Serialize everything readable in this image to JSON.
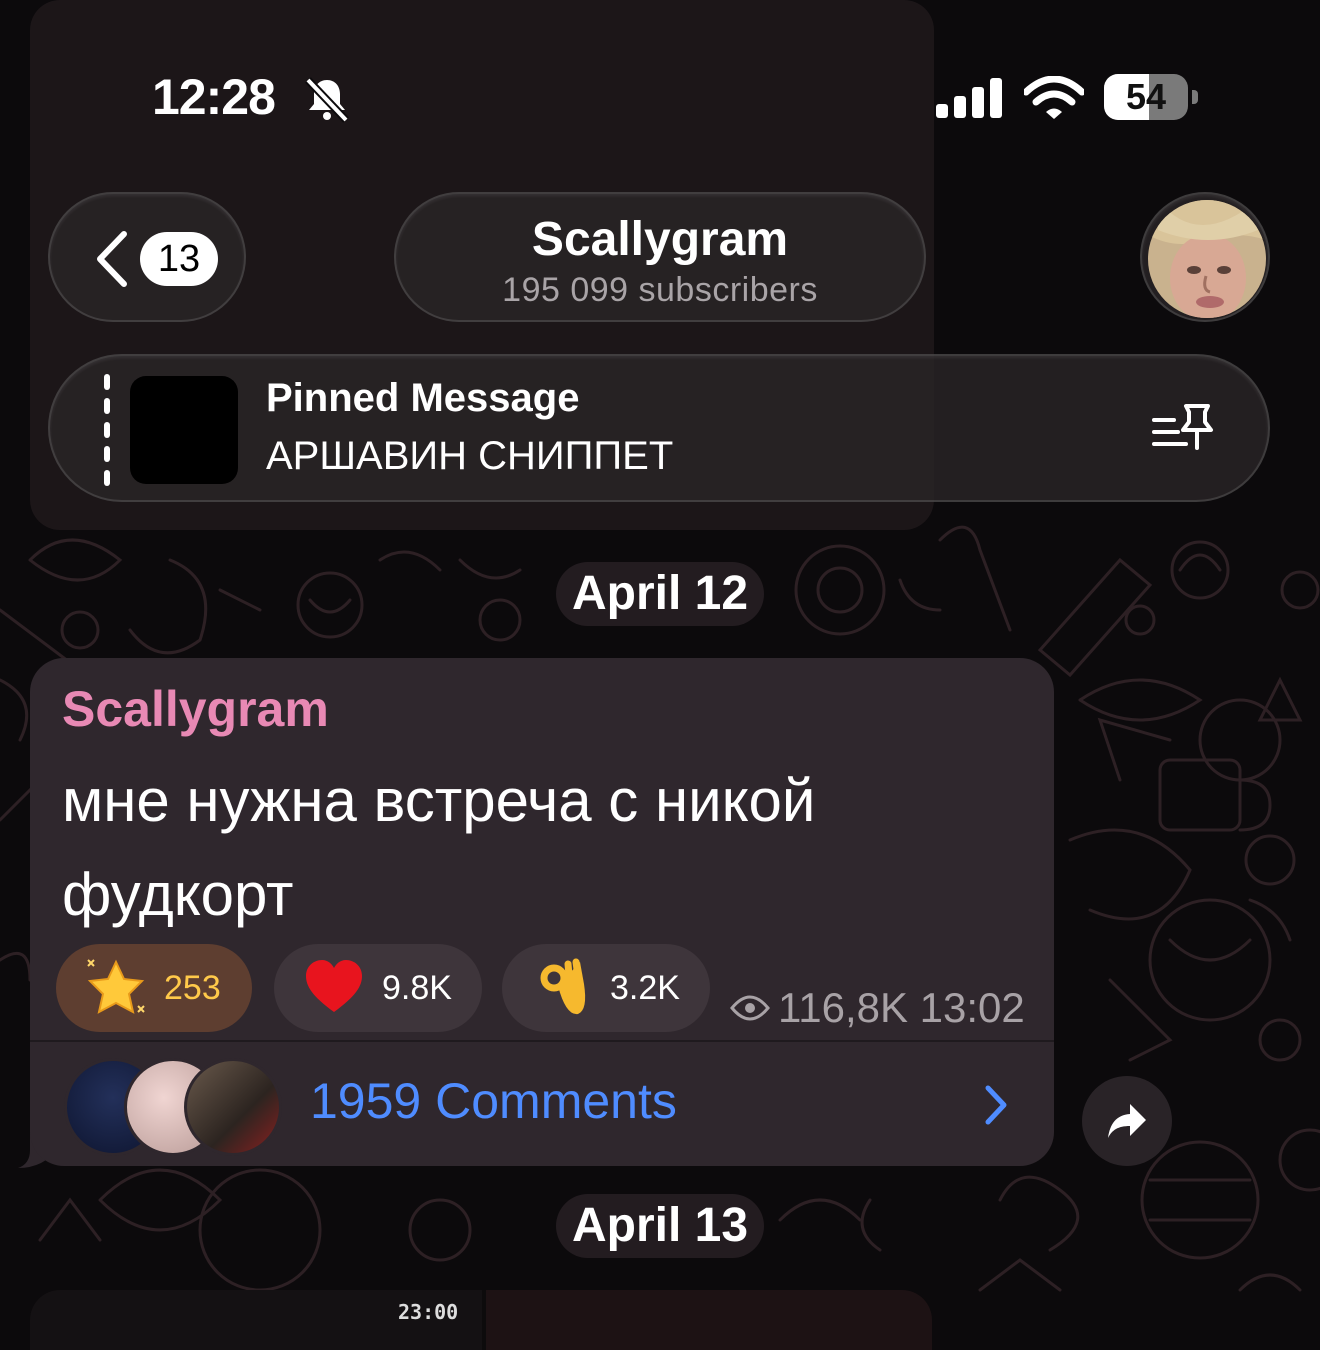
{
  "status_bar": {
    "time": "12:28",
    "silent_icon": "bell-slash-icon",
    "battery": "54",
    "battery_level": 0.54
  },
  "header": {
    "unread_count": "13",
    "channel_name": "Scallygram",
    "subscribers": "195 099 subscribers"
  },
  "pinned": {
    "title": "Pinned Message",
    "text": "АРШАВИН СНИППЕТ"
  },
  "dates": {
    "first": "April 12",
    "second": "April 13"
  },
  "message": {
    "author": "Scallygram",
    "text": "мне нужна встреча с никой фудкорт",
    "reactions": [
      {
        "emoji": "star-icon",
        "count": "253"
      },
      {
        "emoji": "heart-icon",
        "count": "9.8K"
      },
      {
        "emoji": "ok-hand-icon",
        "count": "3.2K"
      }
    ],
    "views": "116,8K",
    "time": "13:02",
    "comments": "1959 Comments"
  },
  "colors": {
    "accent_link": "#4f8cff",
    "author_name": "#e889b4",
    "bubble": "#2f272d"
  }
}
